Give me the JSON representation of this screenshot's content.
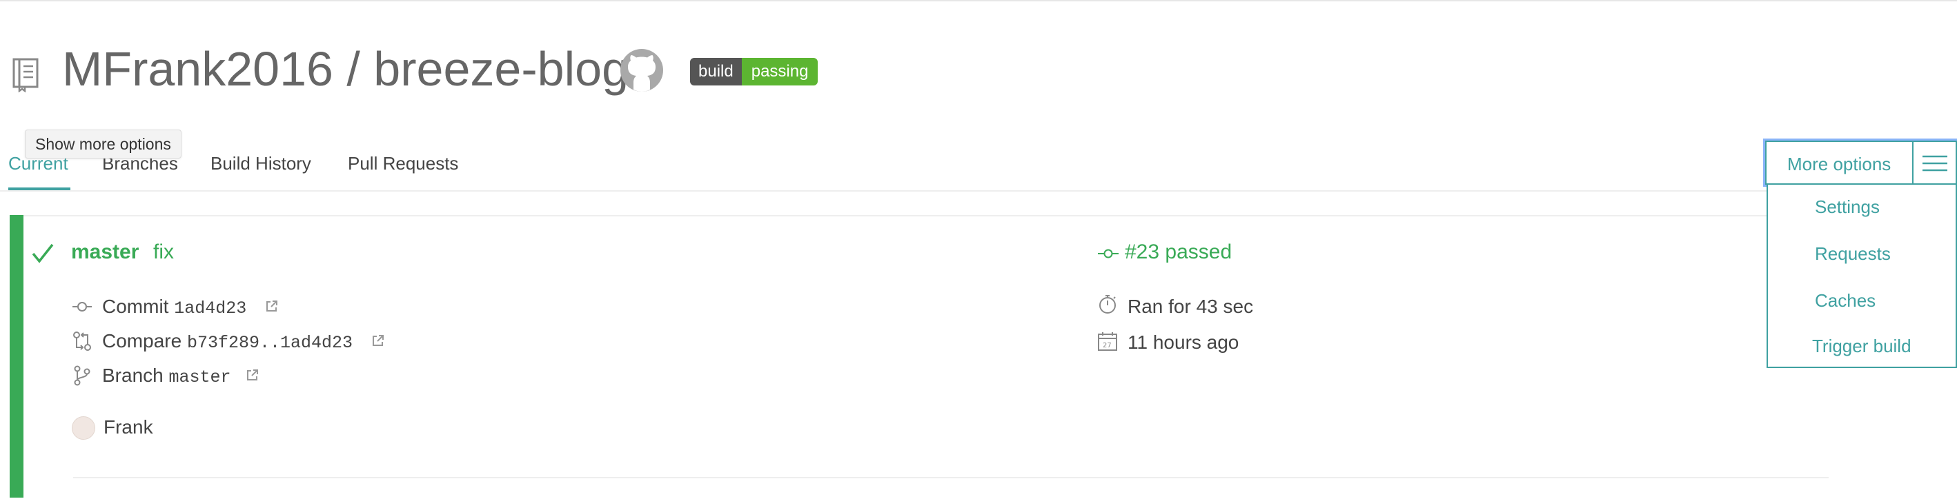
{
  "header": {
    "repo_title": "MFrank2016 / breeze-blog",
    "badge_left": "build",
    "badge_right": "passing",
    "icons": {
      "repo": "repo-book-icon",
      "github": "github-icon"
    }
  },
  "tooltip": "Show more options",
  "tabs": [
    {
      "label": "Current",
      "active": true
    },
    {
      "label": "Branches"
    },
    {
      "label": "Build History"
    },
    {
      "label": "Pull Requests"
    }
  ],
  "build": {
    "branch": "master",
    "message": "fix",
    "number_text": "#23 passed",
    "commit_label": "Commit",
    "commit_sha": "1ad4d23",
    "compare_label": "Compare",
    "compare_range": "b73f289..1ad4d23",
    "branch_label": "Branch",
    "branch_value": "master",
    "duration": "Ran for 43 sec",
    "finished": "11 hours ago",
    "author": "Frank",
    "status_color": "#39aa56"
  },
  "more_options": {
    "label": "More options",
    "items": [
      "Settings",
      "Requests",
      "Caches",
      "Trigger build"
    ]
  },
  "colors": {
    "accent": "#3fa1a1",
    "passed": "#39aa56"
  }
}
